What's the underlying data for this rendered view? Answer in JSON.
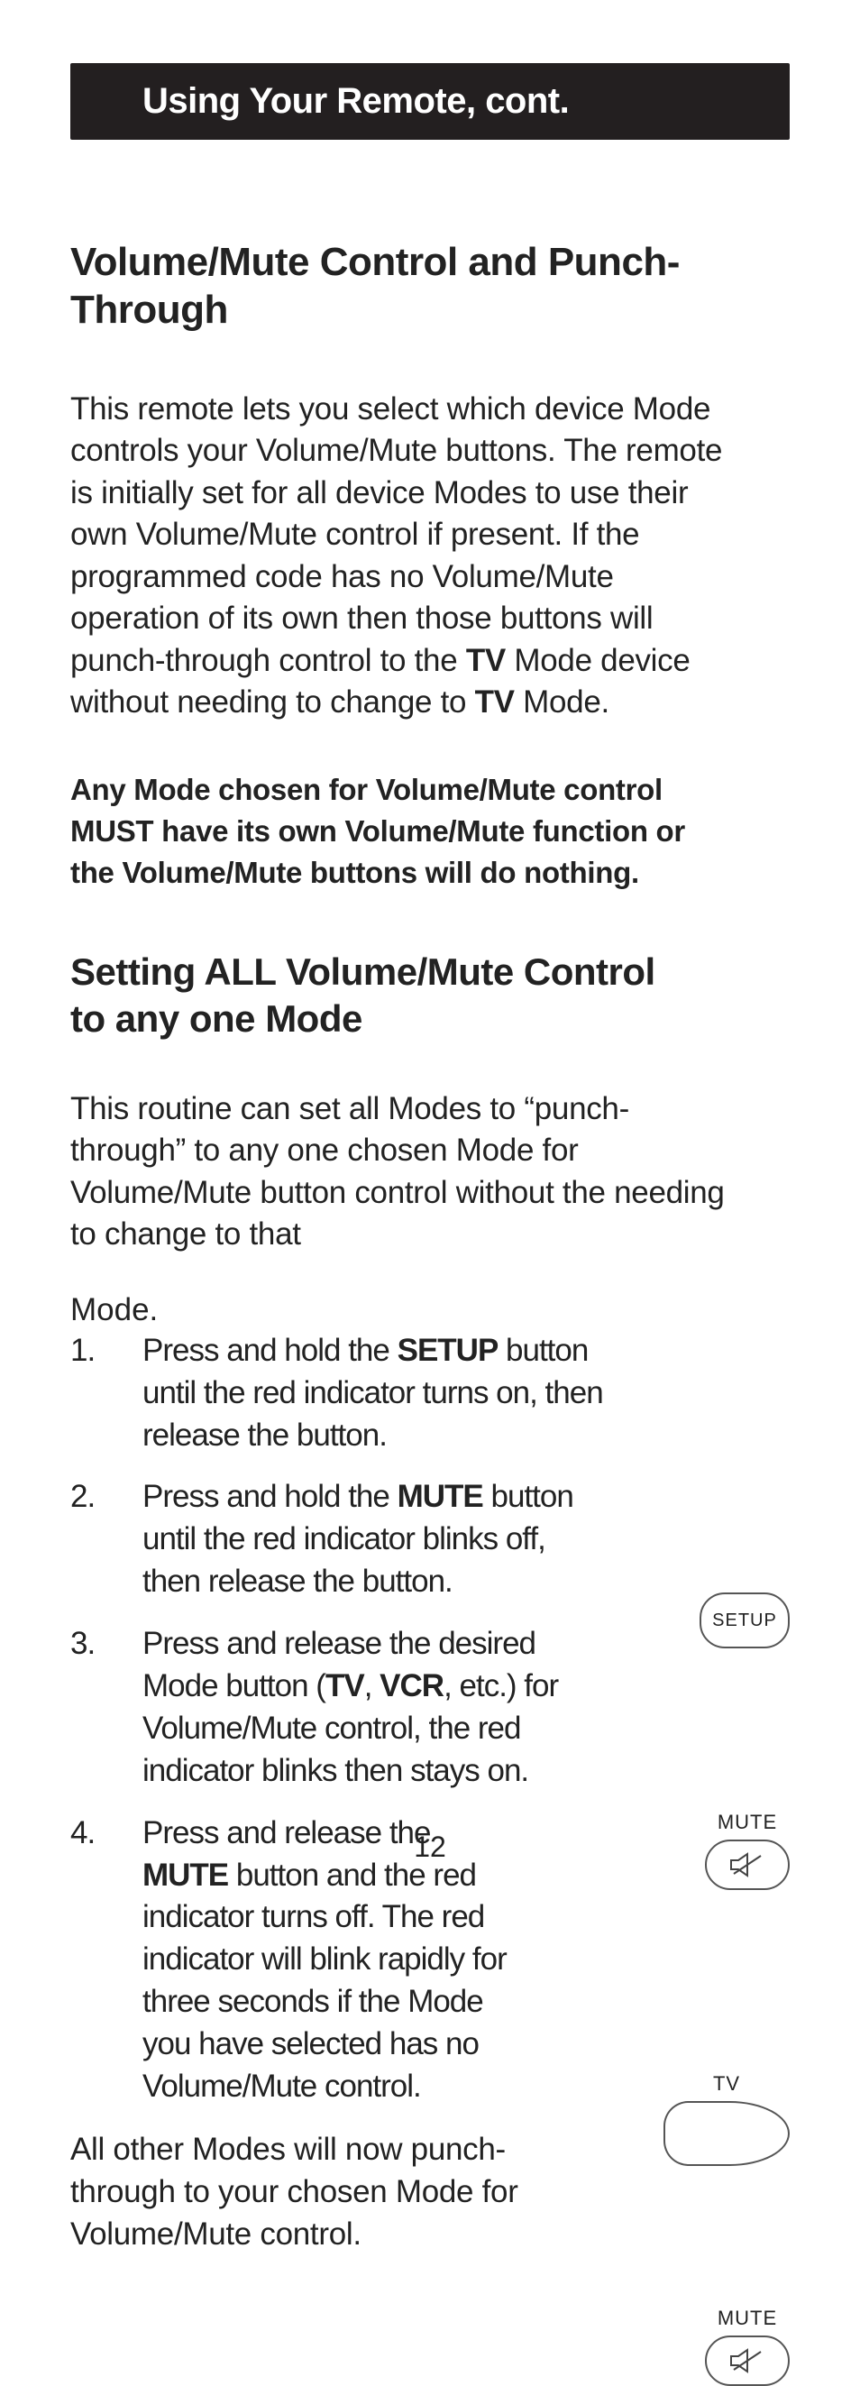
{
  "banner": "Using Your Remote, cont.",
  "h_volume": "Volume/Mute Control and Punch-Through",
  "p1_a": "This remote lets you select which device Mode controls your Volume/Mute buttons. The remote is initially set for all device Modes to use their own Volume/Mute control if present. If the programmed code has no Volume/Mute operation of its own then those buttons will punch-through control to the ",
  "tv1": "TV",
  "p1_b": " Mode device without needing to change to ",
  "tv2": "TV",
  "p1_c": " Mode.",
  "p_bold": "Any Mode chosen for Volume/Mute control MUST have its own Volume/Mute function or the Volume/Mute buttons will do nothing.",
  "h_setting": "Setting ALL Volume/Mute Control to any one Mode",
  "p2": "This routine can set all Modes to “punch-through” to any one chosen Mode for Volume/Mute button control without the needing to change to that",
  "mode_word": "Mode.",
  "steps": {
    "s1a": "Press and hold the ",
    "s1b": "SETUP",
    "s1c": " button until the red indicator turns on, then release the button.",
    "s2a": "Press and hold the ",
    "s2b": "MUTE",
    "s2c": " button until the red indicator blinks off, then release the button.",
    "s3a": "Press and release the desired Mode button (",
    "s3b": "TV",
    "s3c": ", ",
    "s3d": "VCR",
    "s3e": ", etc.) for Volume/Mute control, the red indicator blinks then stays on.",
    "s4a": "Press and release the ",
    "s4b": "MUTE",
    "s4c": " button and the red indicator turns off. The red indicator will blink rapidly for three seconds if the Mode you have selected has no Volume/Mute control."
  },
  "closing": "All other Modes will now punch-through to your chosen Mode for Volume/Mute control.",
  "page_number": "12",
  "btn_labels": {
    "setup": "SETUP",
    "mute": "MUTE",
    "tv": "TV"
  }
}
